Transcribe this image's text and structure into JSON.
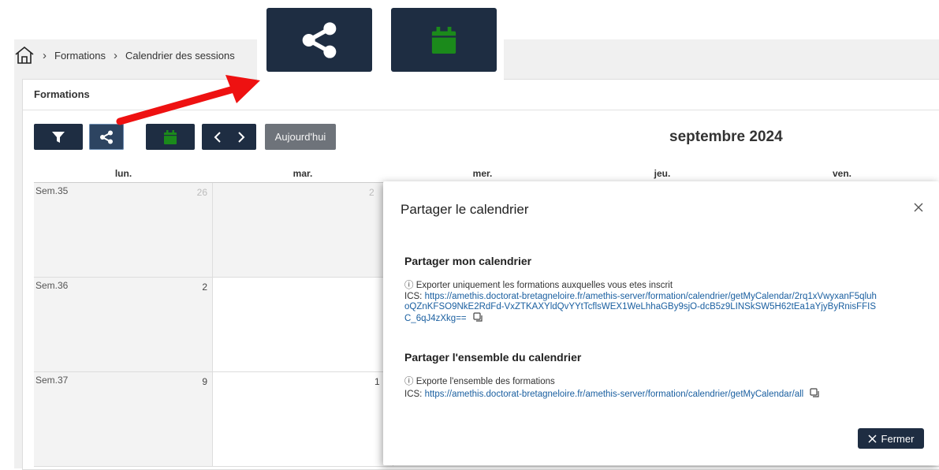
{
  "breadcrumb": {
    "items": [
      "Formations",
      "Calendrier des sessions"
    ]
  },
  "panel": {
    "title": "Formations"
  },
  "toolbar": {
    "today_label": "Aujourd'hui",
    "month_title": "septembre 2024"
  },
  "calendar": {
    "headers": [
      "lun.",
      "mar.",
      "mer.",
      "jeu.",
      "ven."
    ],
    "weeks": [
      {
        "label": "Sem.35",
        "days": [
          "26",
          "2"
        ]
      },
      {
        "label": "Sem.36",
        "days": [
          "2"
        ]
      },
      {
        "label": "Sem.37",
        "days": [
          "9",
          "1"
        ]
      }
    ]
  },
  "modal": {
    "title": "Partager le calendrier",
    "section1": {
      "title": "Partager mon calendrier",
      "info": "Exporter uniquement les formations auxquelles vous etes inscrit",
      "ics_prefix": "ICS: ",
      "url": "https://amethis.doctorat-bretagneloire.fr/amethis-server/formation/calendrier/getMyCalendar/2rq1xVwyxanF5qluhoQZnKFSO9NkE2RdFd-VxZTKAXYldQvYYtTcflsWEX1WeLhhaGBy9sjO-dcB5z9LINSkSW5H62tEa1aYjyByRnisFFISC_6qJ4zXkg=="
    },
    "section2": {
      "title": "Partager l'ensemble du calendrier",
      "info": "Exporte l'ensemble des formations",
      "ics_prefix": "ICS: ",
      "url": "https://amethis.doctorat-bretagneloire.fr/amethis-server/formation/calendrier/getMyCalendar/all"
    },
    "close_label": "Fermer"
  },
  "colors": {
    "navy": "#1e2d42",
    "green": "#1b8a1b",
    "arrow": "#ee1111",
    "link": "#1a5fa0"
  },
  "icons": [
    "home-icon",
    "filter-icon",
    "share-icon",
    "calendar-icon",
    "chevron-left-icon",
    "chevron-right-icon",
    "info-icon",
    "copy-icon",
    "close-icon"
  ]
}
